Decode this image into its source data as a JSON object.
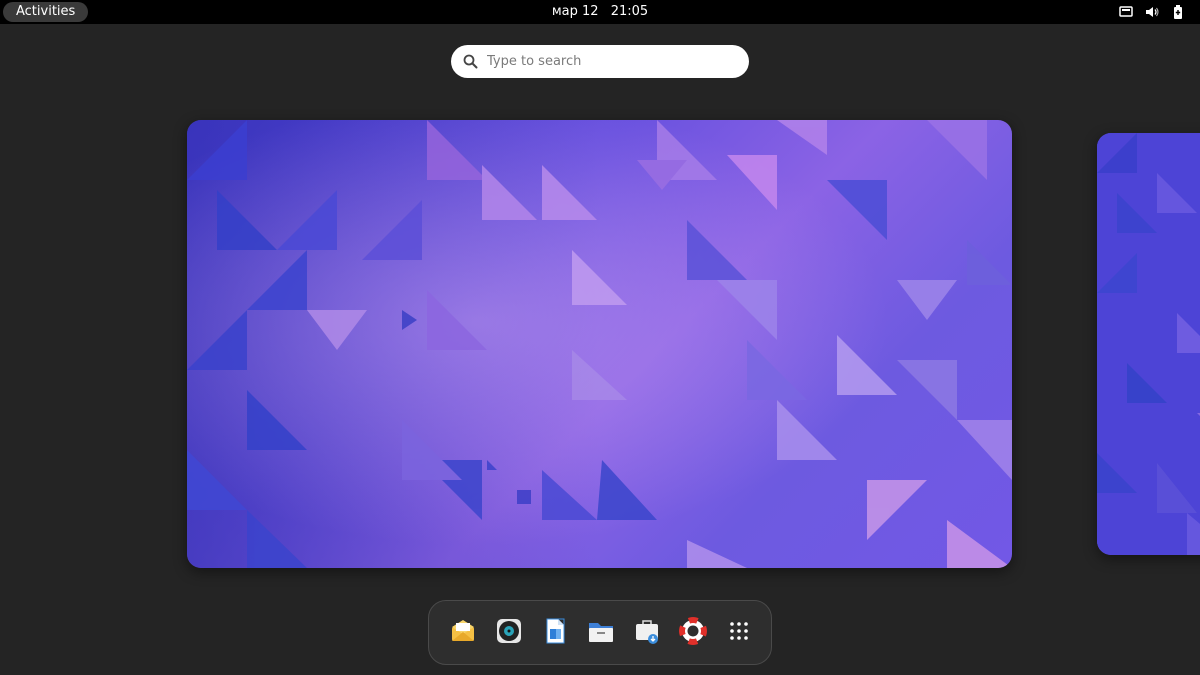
{
  "topbar": {
    "activities_label": "Activities",
    "clock": {
      "date": "мар 12",
      "time": "21:05"
    },
    "tray_icons": [
      "screen-icon",
      "volume-icon",
      "battery-icon"
    ]
  },
  "search": {
    "placeholder": "Type to search",
    "value": ""
  },
  "workspaces": [
    {
      "name": "workspace-1",
      "wallpaper": "purple-triangles"
    },
    {
      "name": "workspace-2",
      "wallpaper": "purple-triangles"
    }
  ],
  "dash": {
    "apps": [
      {
        "icon": "mail-icon"
      },
      {
        "icon": "music-player-icon"
      },
      {
        "icon": "document-writer-icon"
      },
      {
        "icon": "files-icon"
      },
      {
        "icon": "software-icon"
      },
      {
        "icon": "help-lifebuoy-icon"
      },
      {
        "icon": "app-grid-icon"
      }
    ]
  },
  "colors": {
    "background": "#242424",
    "topbar": "#000000",
    "wallpaper_primary": "#6a52df",
    "wallpaper_secondary": "#4a3fd2"
  }
}
